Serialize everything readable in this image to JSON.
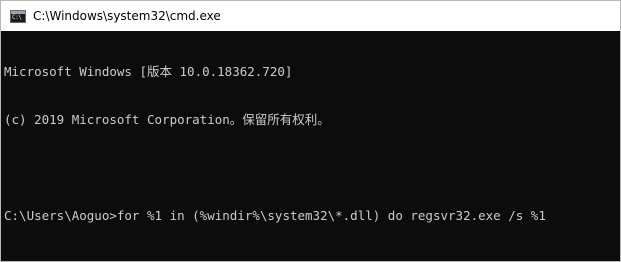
{
  "window": {
    "title": "C:\\Windows\\system32\\cmd.exe",
    "icon": "cmd-console-icon",
    "icon_glyph": "C:\\"
  },
  "console": {
    "lines": [
      "Microsoft Windows [版本 10.0.18362.720]",
      "(c) 2019 Microsoft Corporation。保留所有权利。",
      "",
      "C:\\Users\\Aoguo>for %1 in (%windir%\\system32\\*.dll) do regsvr32.exe /s %1"
    ]
  },
  "colors": {
    "console_background": "#0c0c0c",
    "console_text": "#cccccc",
    "titlebar_background": "#ffffff"
  }
}
